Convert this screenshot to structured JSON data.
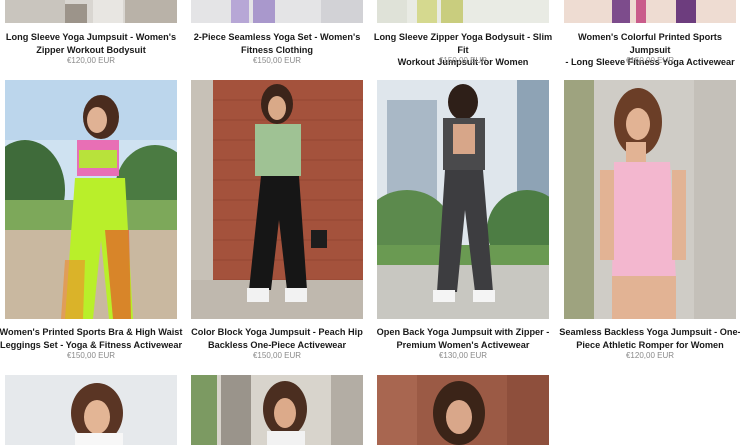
{
  "products_row1": [
    {
      "title_l1": "Long Sleeve Yoga Jumpsuit - Women's",
      "title_l2": "Zipper Workout Bodysuit",
      "price": "€120,00 EUR",
      "image_icon": "product-photo"
    },
    {
      "title_l1": "2-Piece Seamless Yoga Set - Women's",
      "title_l2": "Fitness Clothing",
      "price": "€150,00 EUR",
      "image_icon": "product-photo"
    },
    {
      "title_l1": "Long Sleeve Zipper Yoga Bodysuit - Slim Fit",
      "title_l2": "Workout Jumpsuit for Women",
      "price": "€150,00 EUR",
      "image_icon": "product-photo"
    },
    {
      "title_l1": "Women's Colorful Printed Sports Jumpsuit",
      "title_l2": "- Long Sleeve Fitness Yoga Activewear",
      "price": "€150,00 EUR",
      "image_icon": "product-photo"
    }
  ],
  "products_row2": [
    {
      "title_l1": "Women's Printed Sports Bra & High Waist",
      "title_l2": "Leggings Set - Yoga & Fitness Activewear",
      "price": "€150,00 EUR",
      "image_icon": "product-photo"
    },
    {
      "title_l1": "Color Block Yoga Jumpsuit - Peach Hip",
      "title_l2": "Backless One-Piece Activewear",
      "price": "€150,00 EUR",
      "image_icon": "product-photo"
    },
    {
      "title_l1": "Open Back Yoga Jumpsuit with Zipper -",
      "title_l2": "Premium Women's Activewear",
      "price": "€130,00 EUR",
      "image_icon": "product-photo"
    },
    {
      "title_l1": "Seamless Backless Yoga Jumpsuit - One-",
      "title_l2": "Piece Athletic Romper for Women",
      "price": "€120,00 EUR",
      "image_icon": "product-photo"
    }
  ],
  "products_row3": [
    {
      "image_icon": "product-photo"
    },
    {
      "image_icon": "product-photo"
    },
    {
      "image_icon": "product-photo"
    }
  ],
  "colors": {
    "title_text": "#1a1a1a",
    "price_text": "#8a8a8a",
    "background": "#ffffff"
  }
}
